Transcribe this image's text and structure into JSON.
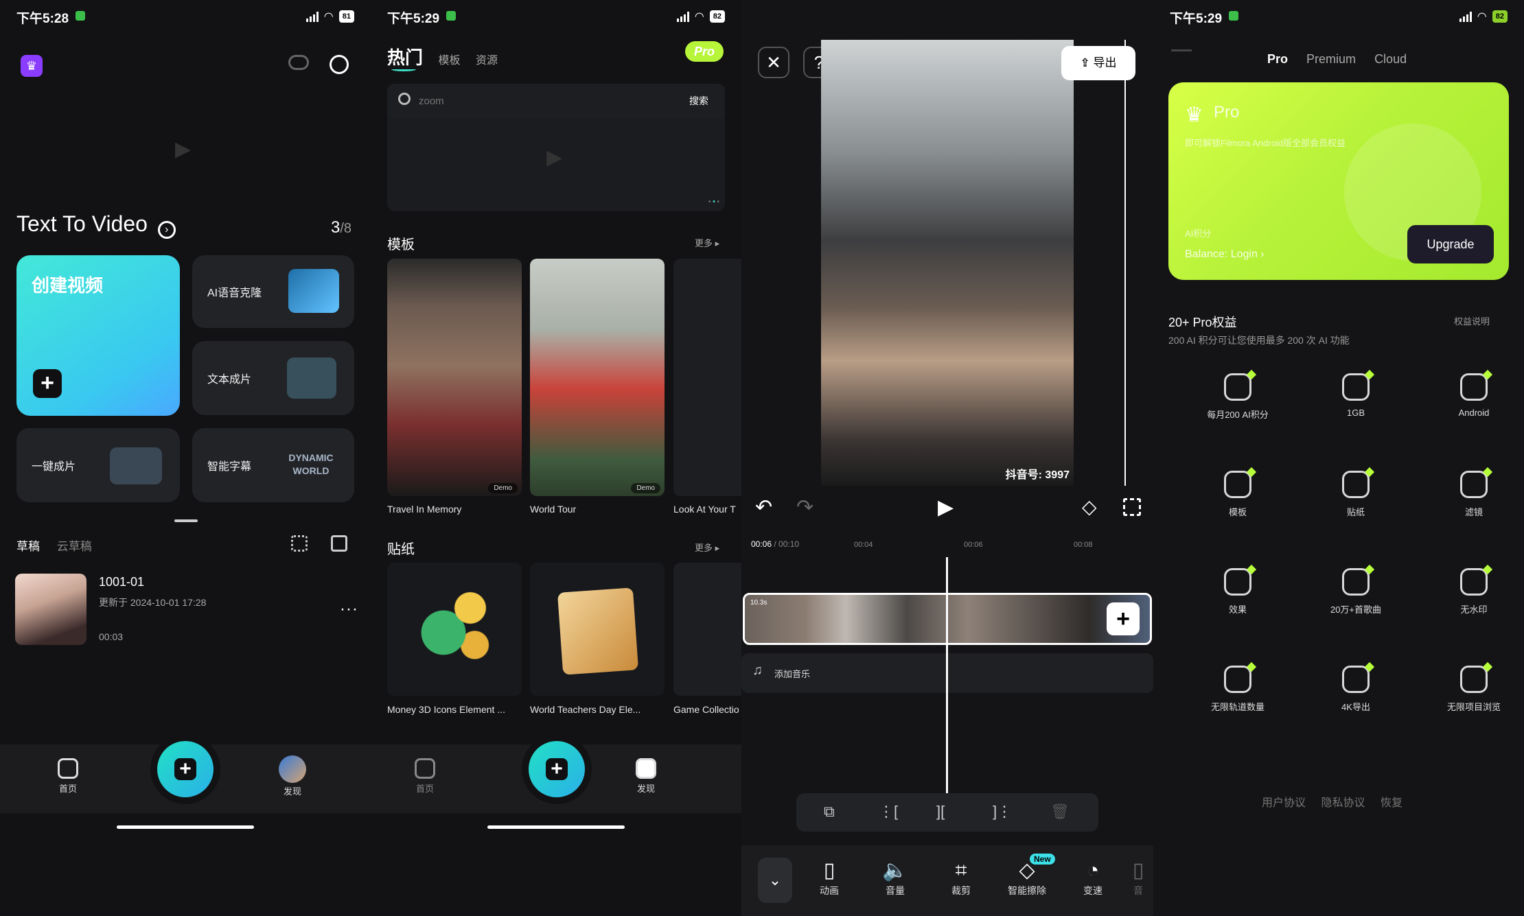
{
  "p1": {
    "status_time": "下午5:28",
    "status_battery": "81",
    "section_title": "Text To Video",
    "counter_main": "3",
    "counter_total": "/8",
    "create_label": "创建视频",
    "cards": [
      {
        "label": "AI语音克隆"
      },
      {
        "label": "文本成片"
      },
      {
        "label": "一键成片"
      },
      {
        "label": "智能字幕",
        "badge": "DYNAMIC WORLD"
      }
    ],
    "tabs": [
      "草稿",
      "云草稿"
    ],
    "draft": {
      "title": "1001-01",
      "updated": "更新于 2024-10-01 17:28",
      "duration": "00:03"
    },
    "nav": [
      "首页",
      "发现"
    ]
  },
  "p2": {
    "status_time": "下午5:29",
    "status_battery": "82",
    "tabs": [
      "热门",
      "模板",
      "资源"
    ],
    "pro": "Pro",
    "search_placeholder": "zoom",
    "search_button": "搜索",
    "templates_title": "模板",
    "more": "更多",
    "templates": [
      "Travel In Memory",
      "World Tour",
      "Look At Your T"
    ],
    "demo": "Demo",
    "stickers_title": "贴纸",
    "stickers": [
      "Money 3D Icons Element ...",
      "World Teachers Day Ele...",
      "Game Collectio"
    ],
    "nav": [
      "首页",
      "发现"
    ]
  },
  "p3": {
    "export": "导出",
    "watermark": "抖音号: 3997",
    "time_current": "00:06",
    "time_total": "/ 00:10",
    "ruler": [
      "00:04",
      "00:06",
      "00:08"
    ],
    "clip_len": "10.3s",
    "add_music": "添加音乐",
    "tools": [
      "动画",
      "音量",
      "裁剪",
      "智能擦除",
      "变速",
      "音"
    ],
    "new_badge": "New"
  },
  "p4": {
    "status_time": "下午5:29",
    "status_battery": "82",
    "tabs": [
      "Pro",
      "Premium",
      "Cloud"
    ],
    "card_title": "Pro",
    "card_desc": "即可解锁Filmora Android版全部会员权益",
    "ai_label": "AI积分",
    "balance": "Balance: Login",
    "upgrade": "Upgrade",
    "perks_title": "20+ Pro权益",
    "perks_link": "权益说明",
    "perks_sub": "200 AI 积分可让您使用最多 200 次 AI 功能",
    "perks": [
      "每月200 AI积分",
      "1GB",
      "Android",
      "模板",
      "贴纸",
      "滤镜",
      "效果",
      "20万+首歌曲",
      "无水印",
      "无限轨道数量",
      "4K导出",
      "无限项目浏览"
    ],
    "footer": [
      "用户协议",
      "隐私协议",
      "恢复"
    ]
  }
}
